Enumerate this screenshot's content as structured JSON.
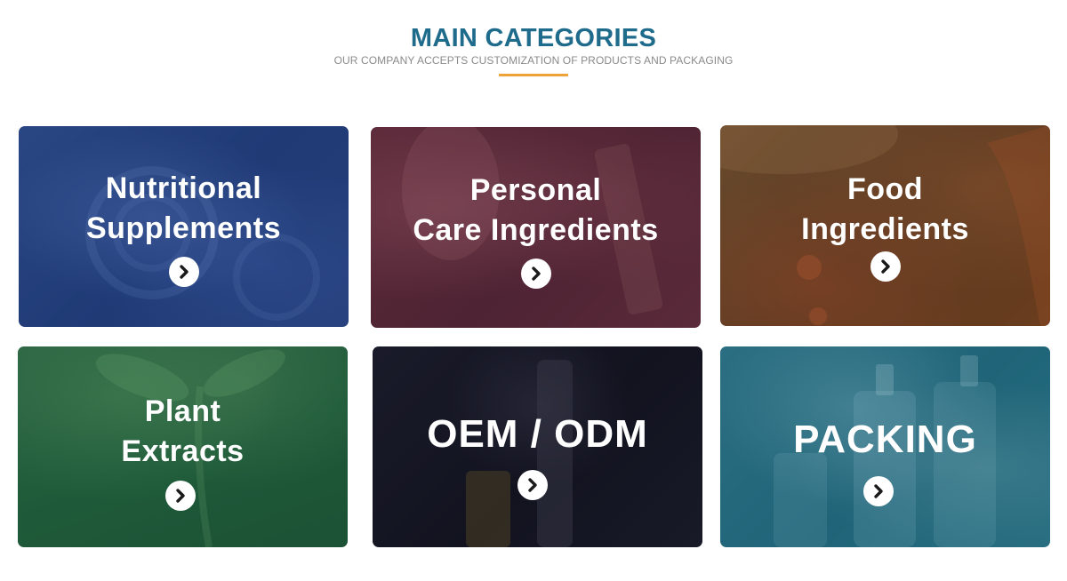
{
  "header": {
    "title": "MAIN CATEGORIES",
    "subtitle": "OUR COMPANY ACCEPTS CUSTOMIZATION OF PRODUCTS AND PACKAGING",
    "accent_color": "#f0a23a",
    "title_color": "#1f6b8c"
  },
  "categories": [
    {
      "line1": "Nutritional",
      "line2": "Supplements",
      "icon": "arrow-right-circle-icon",
      "color": "#2a4683"
    },
    {
      "line1": "Personal",
      "line2": "Care Ingredients",
      "icon": "arrow-right-circle-icon",
      "color": "#5c2a3a"
    },
    {
      "line1": "Food",
      "line2": "Ingredients",
      "icon": "arrow-right-circle-icon",
      "color": "#6a4a2c"
    },
    {
      "line1": "Plant",
      "line2": "Extracts",
      "icon": "arrow-right-circle-icon",
      "color": "#2b6442"
    },
    {
      "line1": "OEM / ODM",
      "icon": "arrow-right-circle-icon",
      "color": "#1a1b2a"
    },
    {
      "line1": "PACKING",
      "icon": "arrow-right-circle-icon",
      "color": "#2b6e82"
    }
  ]
}
